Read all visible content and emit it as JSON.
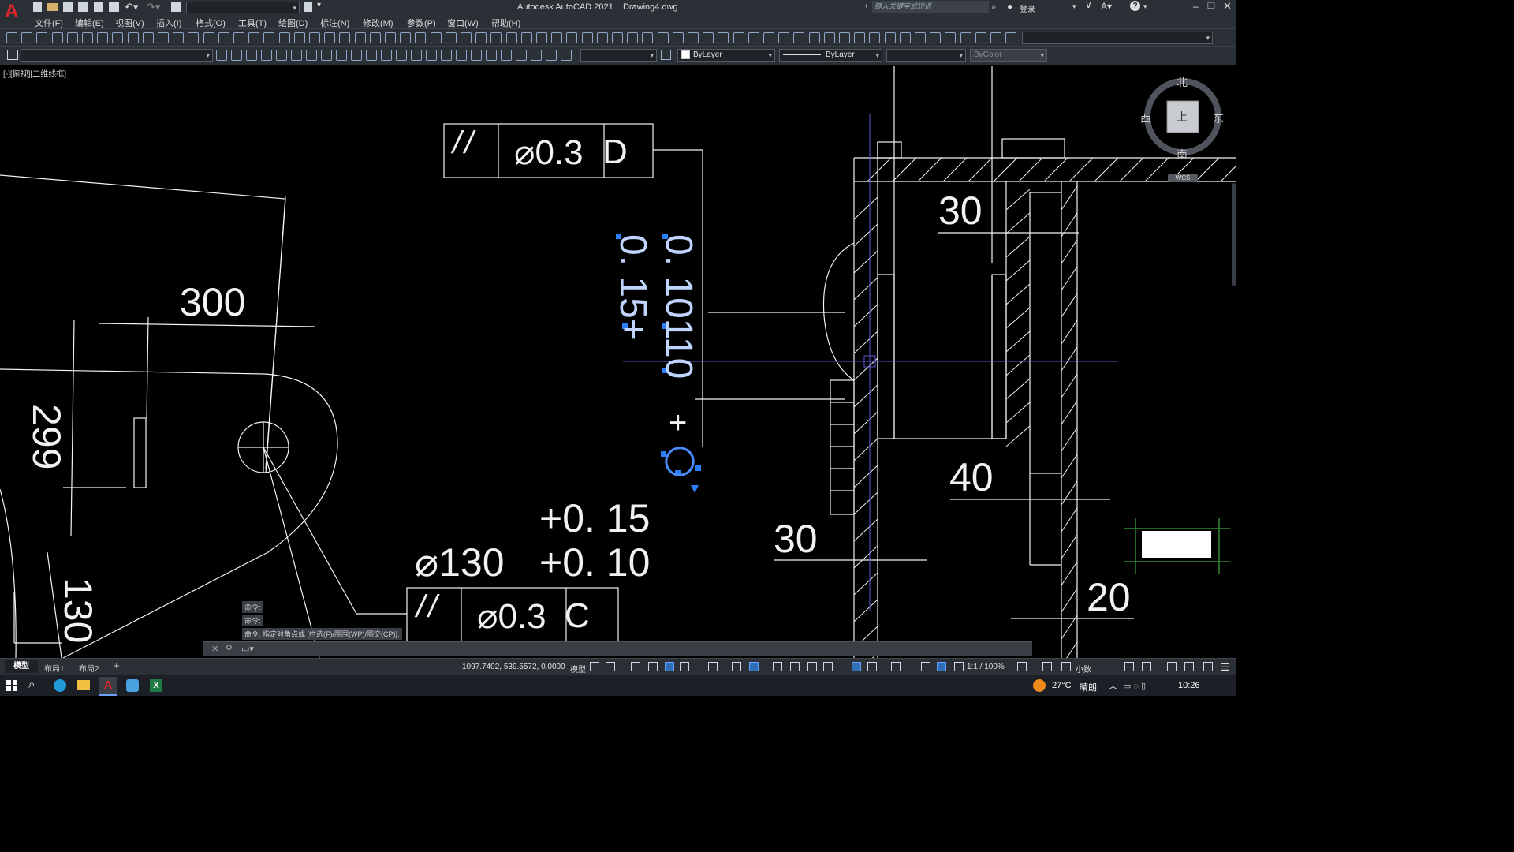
{
  "app": {
    "title": "Autodesk AutoCAD 2021",
    "document": "Drawing4.dwg",
    "search_placeholder": "键入关键字或短语",
    "login": "登录"
  },
  "menu": [
    "文件(F)",
    "编辑(E)",
    "视图(V)",
    "插入(I)",
    "格式(O)",
    "工具(T)",
    "绘图(D)",
    "标注(N)",
    "修改(M)",
    "参数(P)",
    "窗口(W)",
    "帮助(H)"
  ],
  "properties": {
    "color": "ByLayer",
    "linetype": "ByLayer",
    "plotstyle": "ByColor"
  },
  "viewport": {
    "label": "[-][俯视][二维线框]",
    "viewcube": {
      "north": "北",
      "south": "南",
      "east": "东",
      "west": "西",
      "top": "上",
      "wcs": "WCS"
    }
  },
  "drawing": {
    "fcf_top": {
      "symbol": "//",
      "value": "⌀0.3",
      "datum": "D"
    },
    "fcf_bottom": {
      "symbol": "//",
      "value": "⌀0.3",
      "datum": "C"
    },
    "dim_300": "300",
    "dim_299": "299",
    "dim_130_left": "130",
    "dim_130_dia": "⌀130",
    "tol_upper": "+0. 15",
    "tol_lower": "+0. 10",
    "vert_tol_1": "0. 10110",
    "vert_tol_2": "0. 15+",
    "vert_plus": "+",
    "dim_30_top": "30",
    "dim_40": "40",
    "dim_30_bottom": "30",
    "dim_20": "20"
  },
  "command": {
    "line1": "命令:",
    "line2": "命令:",
    "line3": "命令: 指定对角点或 [栏选(F)/圈围(WP)/圈交(CP)]:"
  },
  "tabs": [
    "模型",
    "布局1",
    "布局2"
  ],
  "status": {
    "coords": "1097.7402, 539.5572, 0.0000",
    "model": "模型",
    "scale": "1:1 / 100%",
    "units": "小数"
  },
  "taskbar": {
    "temp": "27°C",
    "weather": "晴朗",
    "time": "10:26"
  },
  "colors": {
    "ui_bg": "#2b2f36",
    "canvas": "#000000",
    "selection": "#1e7bd8",
    "grip": "#2a7fff",
    "ucs_green": "#2e8b2e"
  }
}
